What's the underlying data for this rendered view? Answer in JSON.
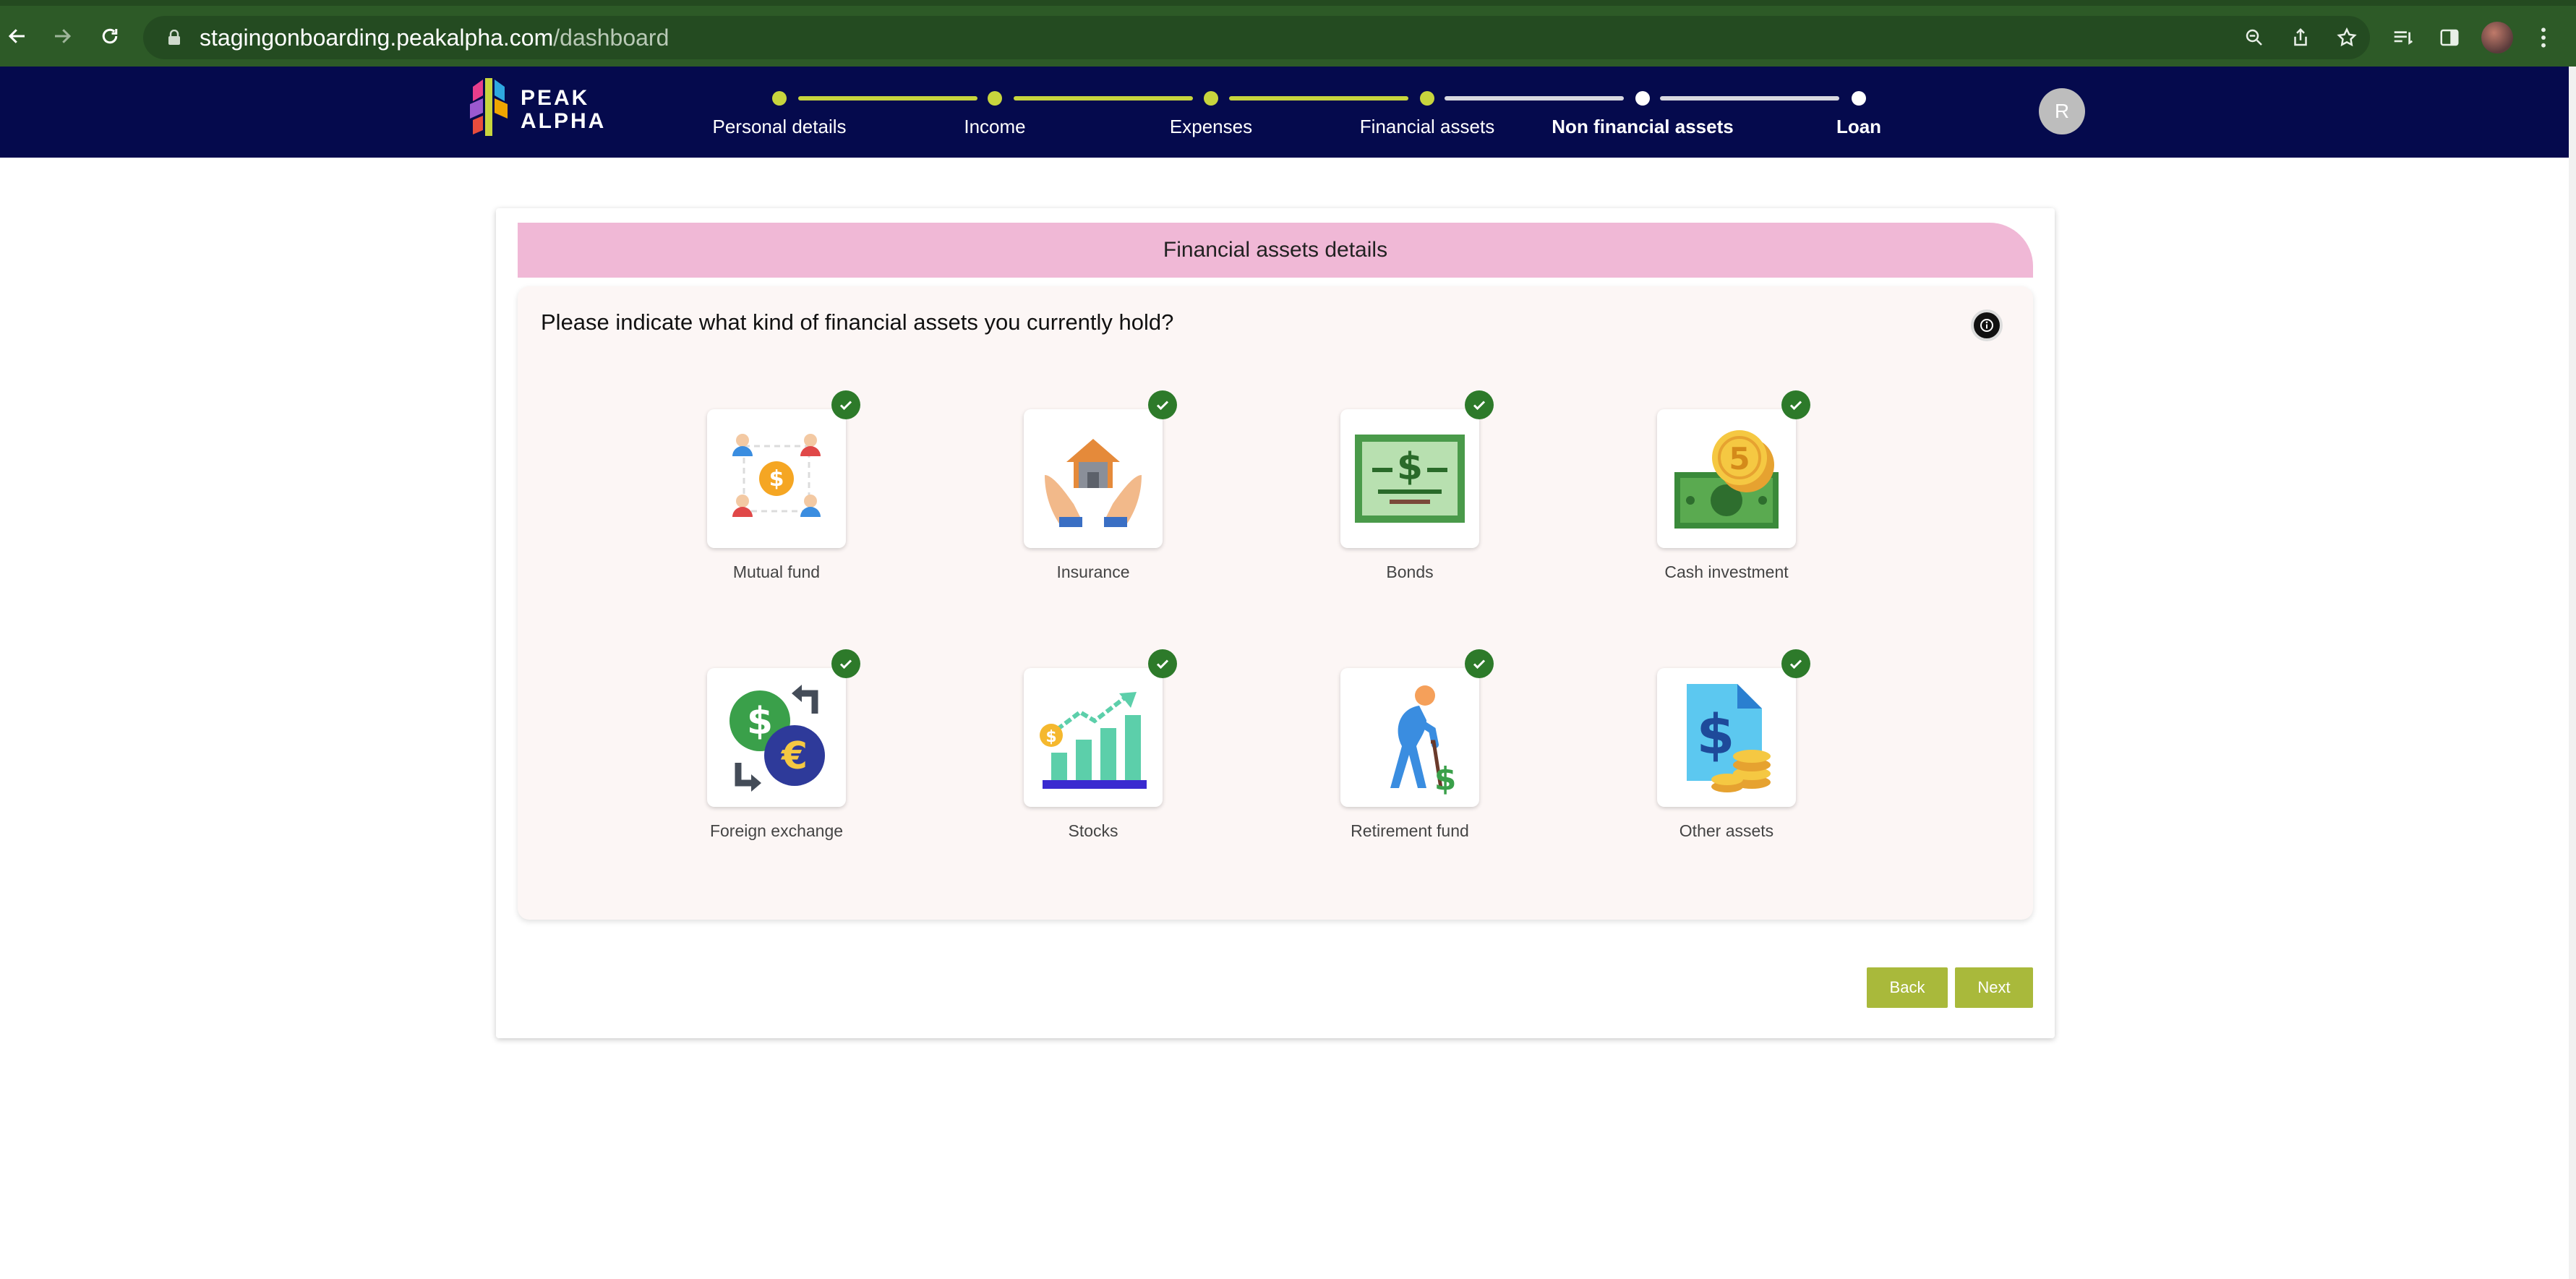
{
  "browser": {
    "url_host": "stagingonboarding.peakalpha.com",
    "url_path": "/dashboard"
  },
  "header": {
    "logo_line1": "PEAK",
    "logo_line2": "ALPHA",
    "avatar_initial": "R",
    "steps": [
      {
        "label": "Personal details",
        "state": "done"
      },
      {
        "label": "Income",
        "state": "done"
      },
      {
        "label": "Expenses",
        "state": "done"
      },
      {
        "label": "Financial assets",
        "state": "current"
      },
      {
        "label": "Non financial assets",
        "state": "upcoming"
      },
      {
        "label": "Loan",
        "state": "upcoming"
      }
    ]
  },
  "main": {
    "section_title": "Financial assets details",
    "question": "Please indicate what kind of financial assets you currently hold?",
    "assets": [
      {
        "label": "Mutual fund",
        "icon": "mutual-fund-icon",
        "selected": true
      },
      {
        "label": "Insurance",
        "icon": "insurance-icon",
        "selected": true
      },
      {
        "label": "Bonds",
        "icon": "bonds-icon",
        "selected": true
      },
      {
        "label": "Cash investment",
        "icon": "cash-investment-icon",
        "selected": true
      },
      {
        "label": "Foreign exchange",
        "icon": "foreign-exchange-icon",
        "selected": true
      },
      {
        "label": "Stocks",
        "icon": "stocks-icon",
        "selected": true
      },
      {
        "label": "Retirement fund",
        "icon": "retirement-fund-icon",
        "selected": true
      },
      {
        "label": "Other assets",
        "icon": "other-assets-icon",
        "selected": true
      }
    ],
    "back_label": "Back",
    "next_label": "Next"
  },
  "colors": {
    "header_bg": "#050a4d",
    "step_done": "#c8d53d",
    "step_upcoming": "#d8d8e0",
    "banner": "#f0b8d6",
    "button": "#a9b93b",
    "check": "#2d7a2a"
  }
}
